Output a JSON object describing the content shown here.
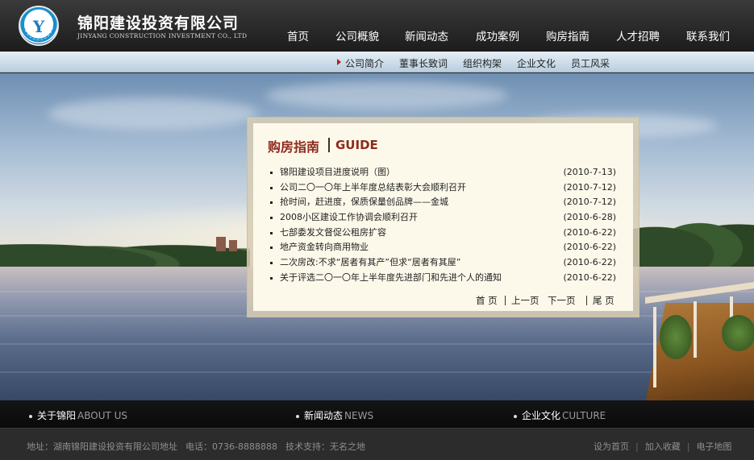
{
  "brand": {
    "name_cn": "锦阳建设投资有限公司",
    "name_en": "JINYANG CONSTRUCTION INVESTMENT CO., LTD",
    "logo_letter": "Y"
  },
  "nav": {
    "items": [
      "首页",
      "公司概貌",
      "新闻动态",
      "成功案例",
      "购房指南",
      "人才招聘",
      "联系我们"
    ]
  },
  "subnav": {
    "items": [
      "公司简介",
      "董事长致词",
      "组织构架",
      "企业文化",
      "员工风采"
    ]
  },
  "guide": {
    "title_cn": "购房指南",
    "title_en": "GUIDE",
    "news": [
      {
        "title": "锦阳建设项目进度说明（图）",
        "date": "(2010-7-13)"
      },
      {
        "title": "公司二〇一〇年上半年度总结表彰大会顺利召开",
        "date": "(2010-7-12)"
      },
      {
        "title": "抢时间，赶进度，保质保量创品牌——金城",
        "date": "(2010-7-12)"
      },
      {
        "title": "2008小区建设工作协调会顺利召开",
        "date": "(2010-6-28)"
      },
      {
        "title": "七部委发文督促公租房扩容",
        "date": "(2010-6-22)"
      },
      {
        "title": "地产资金转向商用物业",
        "date": "(2010-6-22)"
      },
      {
        "title": "二次房改:不求“居者有其产”但求“居者有其屋”",
        "date": "(2010-6-22)"
      },
      {
        "title": "关于评选二〇一〇年上半年度先进部门和先进个人的通知",
        "date": "(2010-6-22)"
      }
    ],
    "pager": {
      "first": "首 页",
      "prev": "上一页",
      "next": "下一页",
      "last": "尾 页"
    }
  },
  "bottom_links": [
    {
      "cn": "关于锦阳",
      "en": "ABOUT US"
    },
    {
      "cn": "新闻动态",
      "en": "NEWS"
    },
    {
      "cn": "企业文化",
      "en": "CULTURE"
    }
  ],
  "footer": {
    "address": "地址：湖南锦阳建设投资有限公司地址",
    "phone": "电话：0736-8888888",
    "support": "技术支持：无名之地",
    "links": [
      "设为首页",
      "加入收藏",
      "电子地图"
    ]
  },
  "colors": {
    "title_red": "#8c2a1d",
    "accent_arrow": "#b0221a",
    "panel_bg": "#fdf9ea"
  }
}
